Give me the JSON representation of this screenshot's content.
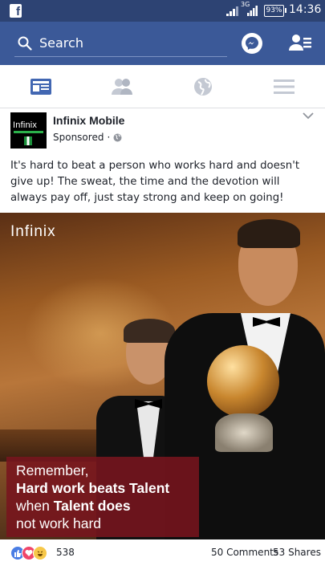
{
  "status_bar": {
    "network": "3G",
    "battery": "93%",
    "time": "14:36"
  },
  "top_bar": {
    "search_placeholder": "Search"
  },
  "post": {
    "page_name": "Infinix Mobile",
    "sponsored_label": "Sponsored",
    "text": "It's hard to beat a person who works hard and doesn't give up! The sweat, the time and the devotion will always pay off, just stay strong and keep on going!",
    "avatar_text": "Infinix",
    "image": {
      "logo": "Infinix",
      "promo_line1": "Remember,",
      "promo_line2": "Hard work beats Talent",
      "promo_line3a": "when ",
      "promo_line3b": "Talent does",
      "promo_line4": "not work hard"
    },
    "footer": {
      "reaction_count": "538",
      "comments": "50 Comments",
      "shares": "53 Shares"
    }
  },
  "colors": {
    "facebook_blue": "#3b5998",
    "status_bar": "#2d4373",
    "promo_box": "#78141e"
  }
}
